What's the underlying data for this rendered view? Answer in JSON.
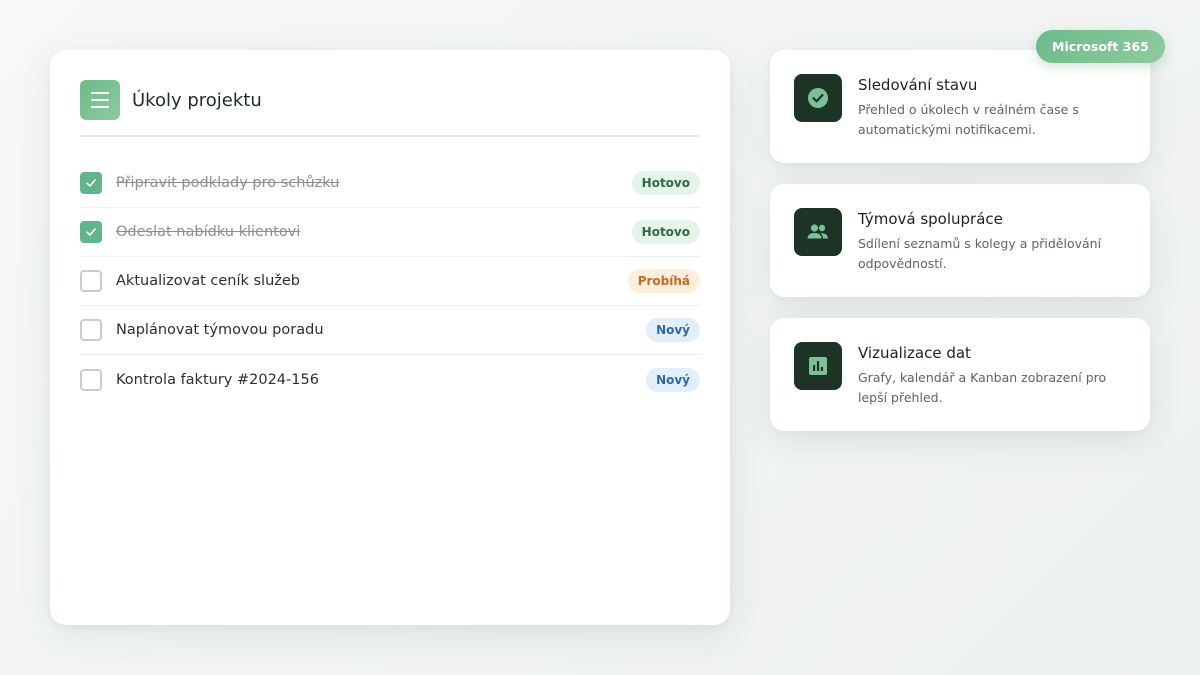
{
  "tasks": {
    "title": "Úkoly projektu",
    "items": [
      {
        "text": "Připravit podklady pro schůzku",
        "done": true,
        "status": "Hotovo",
        "status_key": "hotovo"
      },
      {
        "text": "Odeslat nabídku klientovi",
        "done": true,
        "status": "Hotovo",
        "status_key": "hotovo"
      },
      {
        "text": "Aktualizovat ceník služeb",
        "done": false,
        "status": "Probíhá",
        "status_key": "probiha"
      },
      {
        "text": "Naplánovat týmovou poradu",
        "done": false,
        "status": "Nový",
        "status_key": "novy"
      },
      {
        "text": "Kontrola faktury #2024-156",
        "done": false,
        "status": "Nový",
        "status_key": "novy"
      }
    ]
  },
  "badge": {
    "label": "Microsoft 365"
  },
  "features": [
    {
      "title": "Sledování stavu",
      "desc": "Přehled o úkolech v reálném čase s automatickými notifikacemi.",
      "icon": "check-circle-icon"
    },
    {
      "title": "Týmová spolupráce",
      "desc": "Sdílení seznamů s kolegy a přidělování odpovědností.",
      "icon": "people-icon"
    },
    {
      "title": "Vizualizace dat",
      "desc": "Grafy, kalendář a Kanban zobrazení pro lepší přehled.",
      "icon": "bar-chart-icon"
    }
  ],
  "colors": {
    "accent": "#6cba8a",
    "dark_icon_bg": "#1d3325",
    "done_badge": "#2d6b44",
    "progress_badge": "#c86a1c",
    "new_badge": "#2f6aa8"
  }
}
